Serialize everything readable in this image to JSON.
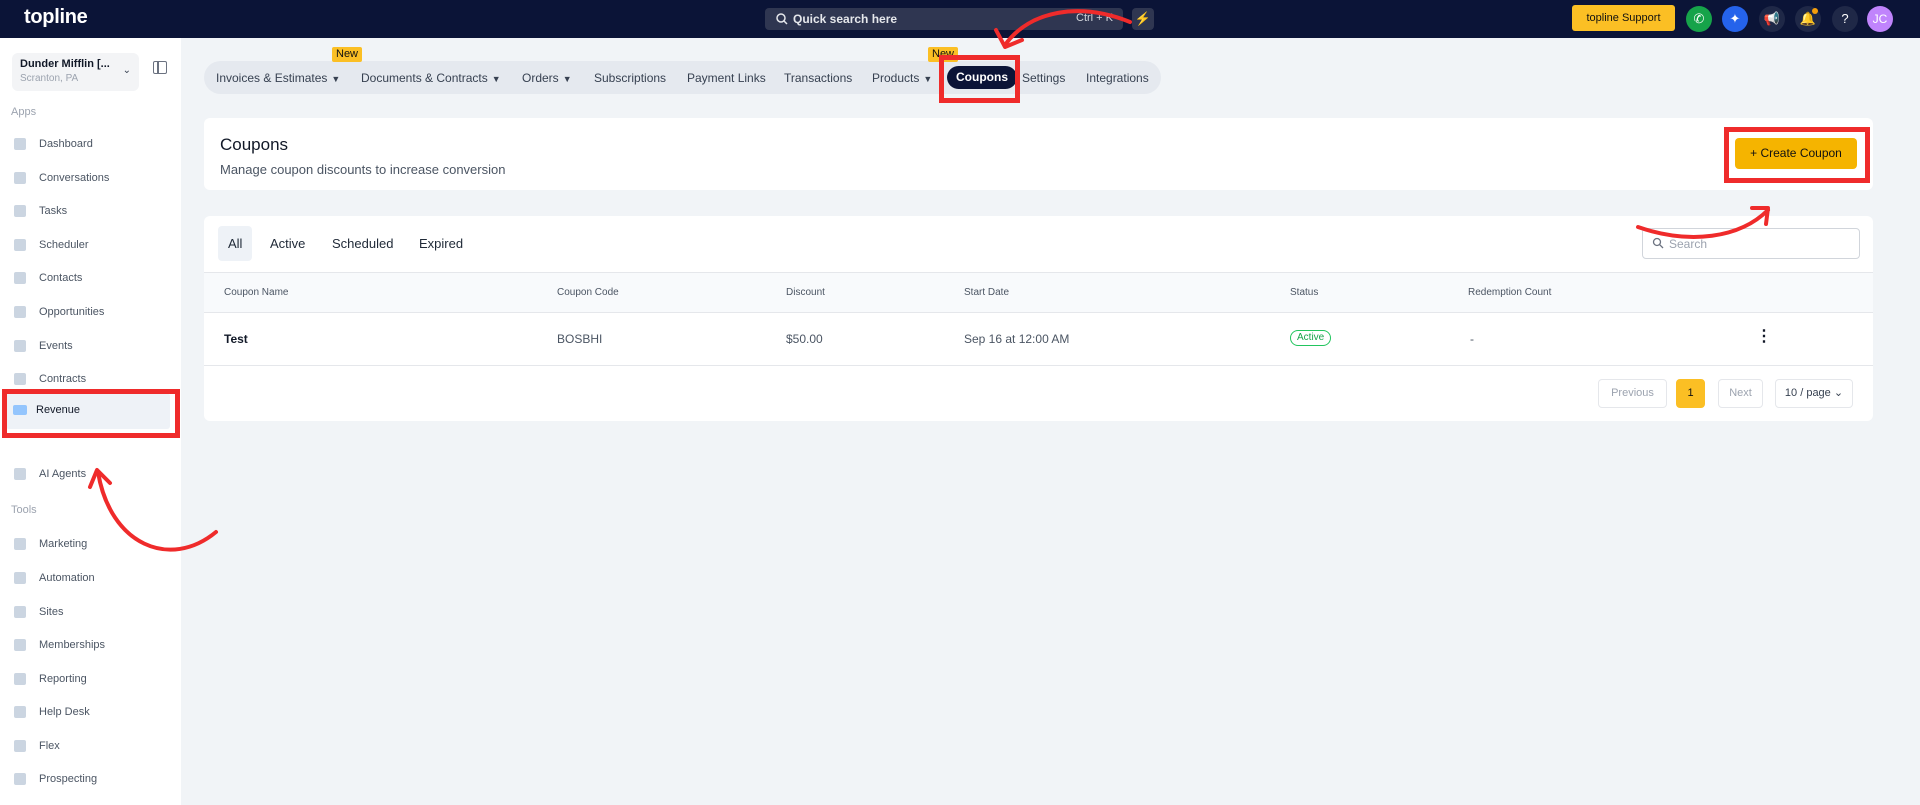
{
  "topbar": {
    "logo": "topline",
    "search_placeholder": "Quick search here",
    "search_shortcut": "Ctrl + K",
    "support_label": "topline Support",
    "avatar_initials": "JC",
    "icons": [
      "bolt-icon",
      "phone-icon",
      "sparkle-icon",
      "megaphone-icon",
      "bell-icon",
      "help-icon"
    ]
  },
  "sidebar": {
    "account_name": "Dunder Mifflin [...",
    "account_location": "Scranton, PA",
    "apps_label": "Apps",
    "apps": [
      {
        "label": "Dashboard"
      },
      {
        "label": "Conversations"
      },
      {
        "label": "Tasks"
      },
      {
        "label": "Scheduler"
      },
      {
        "label": "Contacts"
      },
      {
        "label": "Opportunities"
      },
      {
        "label": "Events"
      },
      {
        "label": "Contracts"
      },
      {
        "label": "Revenue"
      }
    ],
    "ai_agents": "AI Agents",
    "tools_label": "Tools",
    "tools": [
      {
        "label": "Marketing"
      },
      {
        "label": "Automation"
      },
      {
        "label": "Sites"
      },
      {
        "label": "Memberships"
      },
      {
        "label": "Reporting"
      },
      {
        "label": "Help Desk"
      },
      {
        "label": "Flex"
      },
      {
        "label": "Prospecting"
      }
    ]
  },
  "subnav": {
    "items": [
      {
        "label": "Invoices & Estimates"
      },
      {
        "label": "Documents & Contracts"
      },
      {
        "label": "Orders"
      },
      {
        "label": "Subscriptions"
      },
      {
        "label": "Payment Links"
      },
      {
        "label": "Transactions"
      },
      {
        "label": "Products"
      },
      {
        "label": "Coupons"
      },
      {
        "label": "Settings"
      },
      {
        "label": "Integrations"
      }
    ],
    "new_badge": "New",
    "active": "Coupons"
  },
  "header": {
    "title": "Coupons",
    "subtitle": "Manage coupon discounts to increase conversion",
    "create_label": "+ Create Coupon"
  },
  "table": {
    "tabs": [
      {
        "label": "All"
      },
      {
        "label": "Active"
      },
      {
        "label": "Scheduled"
      },
      {
        "label": "Expired"
      }
    ],
    "search_placeholder": "Search",
    "columns": [
      "Coupon Name",
      "Coupon Code",
      "Discount",
      "Start Date",
      "Status",
      "Redemption Count"
    ],
    "rows": [
      {
        "name": "Test",
        "code": "BOSBHI",
        "discount": "$50.00",
        "start": "Sep 16 at 12:00 AM",
        "status": "Active",
        "redemptions": "-"
      }
    ],
    "pagination": {
      "previous": "Previous",
      "current_page": "1",
      "next": "Next",
      "page_size": "10 / page"
    }
  },
  "colors": {
    "topbar": "#0b1437",
    "accent": "#f5b400",
    "annotation": "#ef2b2b",
    "status_active": "#16a34a"
  }
}
